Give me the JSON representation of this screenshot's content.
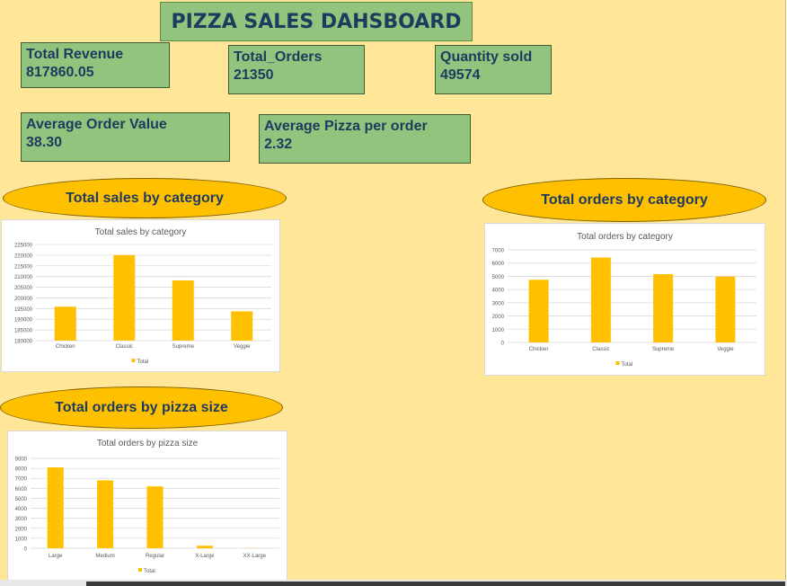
{
  "dashboard": {
    "title": "PIZZA SALES DAHSBOARD"
  },
  "kpis": {
    "total_revenue": {
      "label": "Total Revenue",
      "value": "817860.05"
    },
    "total_orders": {
      "label": "Total_Orders",
      "value": "21350"
    },
    "quantity_sold": {
      "label": "Quantity sold",
      "value": "49574"
    },
    "avg_order_value": {
      "label": "Average Order Value",
      "value": "38.30"
    },
    "avg_pizza_per_order": {
      "label": "Average Pizza per order",
      "value": "2.32"
    }
  },
  "sections": {
    "sales_by_category": "Total sales by category",
    "orders_by_category": "Total orders by category",
    "orders_by_size": "Total orders by pizza size"
  },
  "colors": {
    "background": "#ffe699",
    "kpi_fill": "#93c47d",
    "bar": "#ffc000",
    "pill": "#ffc000",
    "text": "#1f3a5f"
  },
  "chart_data": [
    {
      "id": "sales_by_category",
      "type": "bar",
      "title": "Total sales by category",
      "categories": [
        "Chicken",
        "Classic",
        "Supreme",
        "Veggie"
      ],
      "series": [
        {
          "name": "Total",
          "values": [
            195900,
            220050,
            208200,
            193700
          ]
        }
      ],
      "ylim": [
        180000,
        225000
      ],
      "yticks": [
        180000,
        185000,
        190000,
        195000,
        200000,
        205000,
        210000,
        215000,
        220000,
        225000
      ],
      "legend": "bottom",
      "grid": true
    },
    {
      "id": "orders_by_category",
      "type": "bar",
      "title": "Total orders by category",
      "categories": [
        "Chicken",
        "Classic",
        "Supreme",
        "Veggie"
      ],
      "series": [
        {
          "name": "Total",
          "values": [
            4740,
            6420,
            5160,
            4980
          ]
        }
      ],
      "ylim": [
        0,
        7000
      ],
      "yticks": [
        0,
        1000,
        2000,
        3000,
        4000,
        5000,
        6000,
        7000
      ],
      "legend": "bottom",
      "grid": true
    },
    {
      "id": "orders_by_size",
      "type": "bar",
      "title": "Total orders by pizza size",
      "categories": [
        "Large",
        "Medium",
        "Regular",
        "X-Large",
        "XX-Large"
      ],
      "series": [
        {
          "name": "Total",
          "values": [
            8100,
            6800,
            6200,
            250,
            20
          ]
        }
      ],
      "ylim": [
        0,
        9000
      ],
      "yticks": [
        0,
        1000,
        2000,
        3000,
        4000,
        5000,
        6000,
        7000,
        8000,
        9000
      ],
      "legend": "bottom",
      "grid": true
    }
  ]
}
